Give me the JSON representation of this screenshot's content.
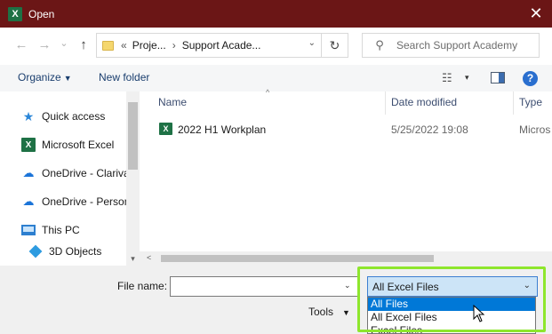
{
  "window": {
    "title": "Open",
    "app_icon": "X",
    "close_glyph": "✕"
  },
  "nav_buttons": {
    "back": "←",
    "forward": "→",
    "dropdown": "⌄",
    "up": "↑"
  },
  "address": {
    "prefix": "«",
    "crumbs": [
      "Proje...",
      "Support Acade..."
    ],
    "separator": "›",
    "dropdown": "⌄",
    "refresh": "↻"
  },
  "search": {
    "placeholder": "Search Support Academy",
    "icon": "⚲"
  },
  "toolbar": {
    "organize_label": "Organize",
    "new_folder_label": "New folder",
    "view_icon": "☷",
    "view_dropdown": "▾",
    "help": "?"
  },
  "sidebar": {
    "items": [
      {
        "label": "Quick access",
        "icon": "★"
      },
      {
        "label": "Microsoft Excel",
        "icon": "X"
      },
      {
        "label": "OneDrive - Clariva",
        "icon": "☁"
      },
      {
        "label": "OneDrive - Person",
        "icon": "☁"
      },
      {
        "label": "This PC",
        "icon": ""
      },
      {
        "label": "3D Objects",
        "icon": ""
      }
    ],
    "scroll_down": "▾"
  },
  "columns": {
    "name": "Name",
    "date_modified": "Date modified",
    "type": "Type",
    "sort_indicator": "^"
  },
  "files": [
    {
      "name": "2022 H1 Workplan",
      "date_modified": "5/25/2022 19:08",
      "type": "Micros",
      "icon": "X"
    }
  ],
  "hscroll": {
    "left_arrow": "<"
  },
  "footer": {
    "file_name_label": "File name:",
    "file_name_value": "",
    "file_name_dropdown": "⌄",
    "file_type_selected": "All Excel Files",
    "file_type_chevron": "⌄",
    "file_type_options": [
      "All Files",
      "All Excel Files",
      "Excel Files"
    ],
    "highlighted_option": "All Files",
    "tools_label": "Tools",
    "tools_caret": "▼"
  },
  "colors": {
    "titlebar": "#6b1616",
    "accent": "#0078d7",
    "highlight_outline": "#8ee62d",
    "excel_green": "#1e7145"
  }
}
